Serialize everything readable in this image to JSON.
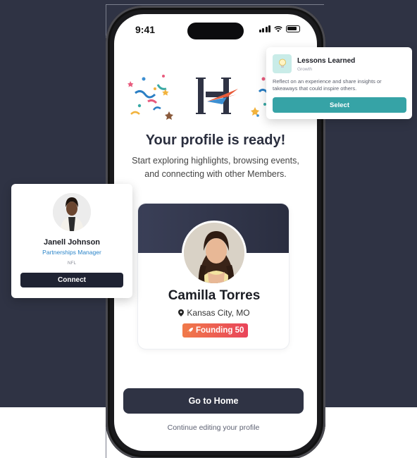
{
  "status_bar": {
    "time": "9:41"
  },
  "main": {
    "headline": "Your profile is ready!",
    "subtext": "Start exploring highlights, browsing events, and connecting with other Members."
  },
  "profile": {
    "name": "Camilla Torres",
    "location": "Kansas City, MO",
    "badge": "Founding 50"
  },
  "actions": {
    "home_button": "Go to Home",
    "edit_link": "Continue editing your profile"
  },
  "lessons_card": {
    "title": "Lessons Learned",
    "tag": "Growth",
    "description": "Reflect on an experience and share insights or takeaways that could inspire others.",
    "button": "Select"
  },
  "member_card": {
    "name": "Janell Johnson",
    "role": "Partnerships Manager",
    "org": "NFL",
    "button": "Connect"
  },
  "colors": {
    "background": "#2f3344",
    "accent_teal": "#36a3a6",
    "primary_dark": "#2f3344",
    "badge_gradient_start": "#f07a4a",
    "badge_gradient_end": "#e9445a",
    "role_blue": "#2b85c9"
  },
  "icons": {
    "location": "map-pin-icon",
    "badge": "rocket-icon",
    "lessons": "lightbulb-icon",
    "logo": "h-logo-icon"
  }
}
